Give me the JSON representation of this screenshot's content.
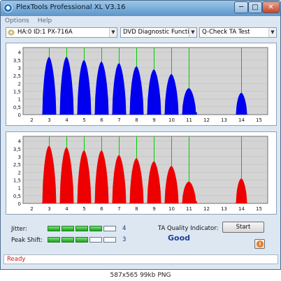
{
  "window": {
    "title": "PlexTools Professional XL V3.16",
    "app_icon": "plextools-icon"
  },
  "title_buttons": {
    "minimize": "─",
    "maximize": "□",
    "close": "✕"
  },
  "menu": [
    {
      "label": "Options"
    },
    {
      "label": "Help"
    }
  ],
  "toolbar": {
    "drive": {
      "value": "HA:0 ID:1  PX-716A",
      "icon": "disc-drive-icon"
    },
    "function": {
      "value": "DVD Diagnostic Functions"
    },
    "test": {
      "value": "Q-Check TA Test"
    }
  },
  "colors": {
    "top_series": "#0000ee",
    "bottom_series": "#ee0000",
    "marker": "#00cc00",
    "plot_bg": "#d4d4d4"
  },
  "chart_data": [
    {
      "type": "area",
      "series": [
        {
          "values": [
            3.7,
            3.7,
            3.5,
            3.4,
            3.3,
            3.1,
            2.9,
            2.6,
            1.7,
            1.4
          ]
        }
      ],
      "x": [
        3,
        4,
        5,
        6,
        7,
        8,
        9,
        10,
        11,
        14
      ],
      "x_ticks": [
        "2",
        "3",
        "4",
        "5",
        "6",
        "7",
        "8",
        "9",
        "10",
        "11",
        "12",
        "13",
        "14",
        "15"
      ],
      "y_ticks": [
        "0",
        "0,5",
        "1",
        "1,5",
        "2",
        "2,5",
        "3",
        "3,5",
        "4"
      ],
      "xlim": [
        1.5,
        15.5
      ],
      "ylim": [
        0,
        4.3
      ],
      "markers": [
        3,
        4,
        5,
        6,
        7,
        8,
        9,
        10,
        11,
        14
      ],
      "grid": true
    },
    {
      "type": "area",
      "series": [
        {
          "values": [
            3.7,
            3.6,
            3.4,
            3.4,
            3.1,
            2.9,
            2.7,
            2.4,
            1.4,
            1.6
          ]
        }
      ],
      "x": [
        3,
        4,
        5,
        6,
        7,
        8,
        9,
        10,
        11,
        14
      ],
      "x_ticks": [
        "2",
        "3",
        "4",
        "5",
        "6",
        "7",
        "8",
        "9",
        "10",
        "11",
        "12",
        "13",
        "14",
        "15"
      ],
      "y_ticks": [
        "0",
        "0,5",
        "1",
        "1,5",
        "2",
        "2,5",
        "3",
        "3,5",
        "4"
      ],
      "xlim": [
        1.5,
        15.5
      ],
      "ylim": [
        0,
        4.3
      ],
      "markers": [
        3,
        4,
        5,
        6,
        7,
        8,
        9,
        10,
        11,
        14
      ],
      "grid": true
    }
  ],
  "metrics": {
    "jitter": {
      "label": "Jitter:",
      "value": "4",
      "level": 4,
      "max": 5
    },
    "peak_shift": {
      "label": "Peak Shift:",
      "value": "3",
      "level": 3,
      "max": 5
    },
    "ta_quality": {
      "label": "TA Quality Indicator:",
      "value": "Good"
    }
  },
  "buttons": {
    "start": "Start",
    "info_icon": "info-icon"
  },
  "status": {
    "text": "Ready"
  },
  "caption": "587x565 99kb PNG"
}
